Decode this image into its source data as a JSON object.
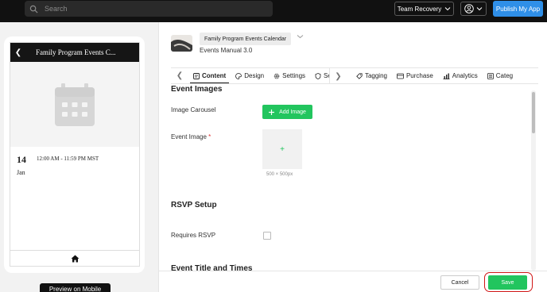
{
  "header": {
    "search_placeholder": "Search",
    "team_label": "Team Recovery",
    "publish_label": "Publish My App"
  },
  "preview": {
    "screen_title": "Family Program Events C...",
    "event_day": "14",
    "event_month": "Jan",
    "event_time": "12:00 AM - 11:59 PM MST",
    "preview_button": "Preview on Mobile"
  },
  "app": {
    "name": "Family Program Events Calendar",
    "subtitle": "Events Manual 3.0"
  },
  "tabs": [
    {
      "label": "Content",
      "icon": "content-icon"
    },
    {
      "label": "Design",
      "icon": "palette-icon"
    },
    {
      "label": "Settings",
      "icon": "gear-icon"
    },
    {
      "label": "Security",
      "icon": "shield-icon"
    },
    {
      "label": "Tagging",
      "icon": "tag-icon"
    },
    {
      "label": "Purchase",
      "icon": "card-icon"
    },
    {
      "label": "Analytics",
      "icon": "bar-chart-icon"
    },
    {
      "label": "Categ",
      "icon": "category-icon"
    }
  ],
  "form": {
    "section_images": "Event Images",
    "image_carousel_label": "Image Carousel",
    "add_image_label": "Add Image",
    "event_image_label": "Event Image",
    "required_mark": "*",
    "image_hint": "500 × 500px",
    "section_rsvp": "RSVP Setup",
    "requires_rsvp_label": "Requires RSVP",
    "section_title_times": "Event Title and Times"
  },
  "footer": {
    "cancel_label": "Cancel",
    "save_label": "Save"
  },
  "colors": {
    "accent_green": "#22c55e",
    "publish_blue": "#2f8fe8",
    "highlight_red": "#d01515"
  }
}
